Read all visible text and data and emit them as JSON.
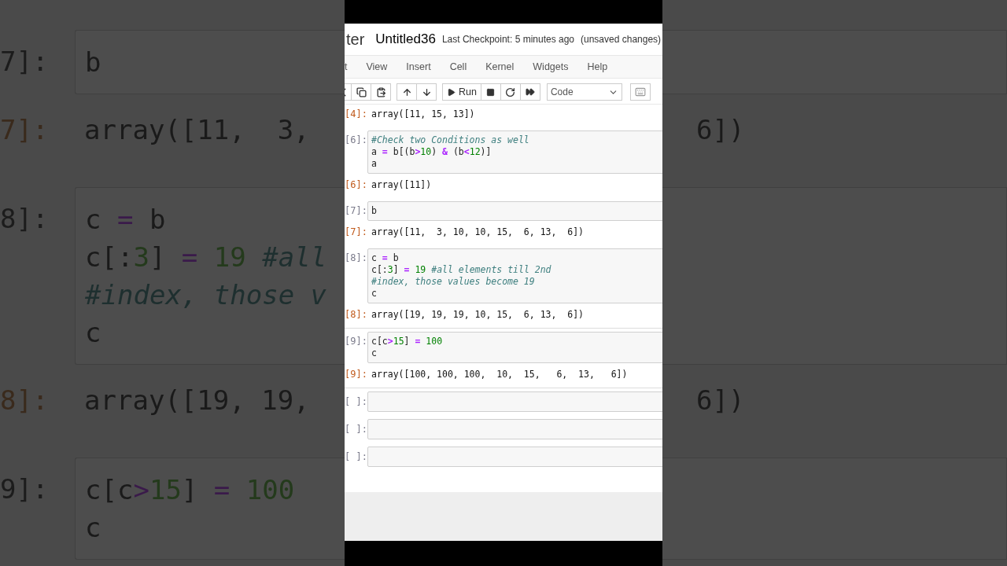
{
  "backdrop_left": {
    "cells": [
      {
        "kind": "input",
        "prompt": "7]:",
        "lines": [
          [
            {
              "text": "b",
              "kind": "plain"
            }
          ]
        ]
      },
      {
        "kind": "output",
        "prompt": "7]:",
        "text": "array([11,  3,"
      },
      {
        "kind": "input",
        "prompt": "8]:",
        "lines": [
          [
            {
              "text": "c ",
              "kind": "plain"
            },
            {
              "text": "=",
              "kind": "op"
            },
            {
              "text": " b",
              "kind": "plain"
            }
          ],
          [
            {
              "text": "c[:",
              "kind": "plain"
            },
            {
              "text": "3",
              "kind": "num"
            },
            {
              "text": "] ",
              "kind": "plain"
            },
            {
              "text": "=",
              "kind": "op"
            },
            {
              "text": " 19",
              "kind": "num"
            },
            {
              "text": " #all",
              "kind": "comment"
            }
          ],
          [
            {
              "text": "#index, those v",
              "kind": "comment"
            }
          ],
          [
            {
              "text": "c",
              "kind": "plain"
            }
          ]
        ]
      },
      {
        "kind": "output",
        "prompt": "8]:",
        "text": "array([19, 19,"
      },
      {
        "kind": "input",
        "prompt": "9]:",
        "lines": [
          [
            {
              "text": "c[c",
              "kind": "plain"
            },
            {
              "text": ">",
              "kind": "op"
            },
            {
              "text": "15",
              "kind": "num"
            },
            {
              "text": "] ",
              "kind": "plain"
            },
            {
              "text": "=",
              "kind": "op"
            },
            {
              "text": " 100",
              "kind": "num"
            }
          ],
          [
            {
              "text": "c",
              "kind": "plain"
            }
          ]
        ]
      }
    ]
  },
  "backdrop_right": {
    "cells": [
      {
        "kind": "input"
      },
      {
        "kind": "output",
        "text": "6])"
      },
      {
        "kind": "input"
      },
      {
        "kind": "output",
        "text": "6])"
      },
      {
        "kind": "input"
      }
    ]
  },
  "header": {
    "logo_text": "ter",
    "notebook_name": "Untitled36",
    "checkpoint": "Last Checkpoint: 5 minutes ago",
    "status": "(unsaved changes)"
  },
  "menu": [
    "t",
    "View",
    "Insert",
    "Cell",
    "Kernel",
    "Widgets",
    "Help"
  ],
  "toolbar": {
    "run_label": "Run",
    "cell_type": "Code"
  },
  "cells": [
    {
      "kind": "output",
      "prompt": "[4]:",
      "text": "array([11, 15, 13])"
    },
    {
      "kind": "input",
      "prompt": "[6]:",
      "lines": [
        [
          {
            "text": "#Check two Conditions as well",
            "kind": "comment"
          }
        ],
        [
          {
            "text": "a ",
            "kind": "plain"
          },
          {
            "text": "=",
            "kind": "op"
          },
          {
            "text": " b[(b",
            "kind": "plain"
          },
          {
            "text": ">",
            "kind": "op"
          },
          {
            "text": "10",
            "kind": "num"
          },
          {
            "text": ") ",
            "kind": "plain"
          },
          {
            "text": "&",
            "kind": "op"
          },
          {
            "text": " (b",
            "kind": "plain"
          },
          {
            "text": "<",
            "kind": "op"
          },
          {
            "text": "12",
            "kind": "num"
          },
          {
            "text": ")]",
            "kind": "plain"
          }
        ],
        [
          {
            "text": "a",
            "kind": "plain"
          }
        ]
      ]
    },
    {
      "kind": "output",
      "prompt": "[6]:",
      "text": "array([11])"
    },
    {
      "kind": "input",
      "prompt": "[7]:",
      "lines": [
        [
          {
            "text": "b",
            "kind": "plain"
          }
        ]
      ]
    },
    {
      "kind": "output",
      "prompt": "[7]:",
      "text": "array([11,  3, 10, 10, 15,  6, 13,  6])"
    },
    {
      "kind": "input",
      "prompt": "[8]:",
      "lines": [
        [
          {
            "text": "c ",
            "kind": "plain"
          },
          {
            "text": "=",
            "kind": "op"
          },
          {
            "text": " b",
            "kind": "plain"
          }
        ],
        [
          {
            "text": "c[:",
            "kind": "plain"
          },
          {
            "text": "3",
            "kind": "num"
          },
          {
            "text": "] ",
            "kind": "plain"
          },
          {
            "text": "=",
            "kind": "op"
          },
          {
            "text": " 19",
            "kind": "num"
          },
          {
            "text": " #all elements till 2nd",
            "kind": "comment"
          }
        ],
        [
          {
            "text": "#index, those values become 19",
            "kind": "comment"
          }
        ],
        [
          {
            "text": "c",
            "kind": "plain"
          }
        ]
      ]
    },
    {
      "kind": "output",
      "prompt": "[8]:",
      "text": "array([19, 19, 19, 10, 15,  6, 13,  6])"
    },
    {
      "kind": "input",
      "prompt": "[9]:",
      "lines": [
        [
          {
            "text": "c[c",
            "kind": "plain"
          },
          {
            "text": ">",
            "kind": "op"
          },
          {
            "text": "15",
            "kind": "num"
          },
          {
            "text": "] ",
            "kind": "plain"
          },
          {
            "text": "=",
            "kind": "op"
          },
          {
            "text": " 100",
            "kind": "num"
          }
        ],
        [
          {
            "text": "c",
            "kind": "plain"
          }
        ]
      ]
    },
    {
      "kind": "output",
      "prompt": "[9]:",
      "text": "array([100, 100, 100,  10,  15,   6,  13,   6])"
    },
    {
      "kind": "empty",
      "prompt": "[ ]:"
    },
    {
      "kind": "empty",
      "prompt": "[ ]:"
    },
    {
      "kind": "empty",
      "prompt": "[ ]:"
    }
  ]
}
